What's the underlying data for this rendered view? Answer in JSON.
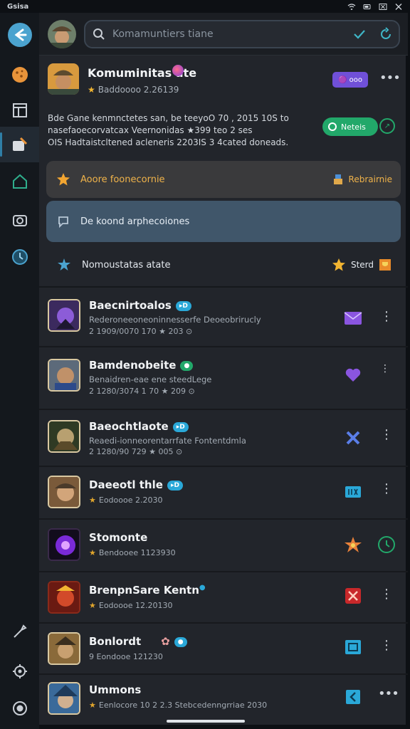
{
  "status": {
    "time": "Gsisa"
  },
  "search": {
    "placeholder": "Komamuntiers tiane"
  },
  "header": {
    "title": "Komuminitas ate",
    "subtitle": "Baddoooo 2.26139",
    "pill_label": "🟣 ooo"
  },
  "description": {
    "line1": "Bde Gane kenmnctetes san, be teeyoO 70 , 2015 10S to",
    "line2": "nasefaoecorvatcax Veernonidas ★399 teo 2 ses",
    "line3": "OIS Hadtaistcltened acleneris 2203IS 3 4cated doneads."
  },
  "follow_button": {
    "label": "Neteis"
  },
  "menu": [
    {
      "label": "Aoore foonecornie",
      "right_label": "Rebrairnie"
    },
    {
      "label": "De koond arphecoiones",
      "right_label": ""
    },
    {
      "label": "Nomoustatas atate",
      "right_label": "Sterd"
    }
  ],
  "games": [
    {
      "name": "Baecnirtoalos",
      "badge": "▸D",
      "line2": "Rederoneeoneoninnesserfe Deoeobrirucly",
      "line3": "2 1909/0070 170 ★ 203 ⊙"
    },
    {
      "name": "Bamdenobeite",
      "badge": "",
      "line2": "Benaidren-eae ene steedLege",
      "line3": "2 1280/3074 1 70 ★ 209 ⊙"
    },
    {
      "name": "Baeochtlaote",
      "badge": "▸D",
      "line2": "Reaedi-ionneorentarrfate Fontentdmla",
      "line3": "2 1280/90 729 ★ 005 ⊙"
    },
    {
      "name": "Daeeotl thle",
      "badge": "▸D",
      "line2": "",
      "line3": "Eodoooe 2.2030"
    },
    {
      "name": "Stomonte",
      "badge": "",
      "line2": "",
      "line3": "Bendooee 1123930"
    },
    {
      "name": "BrenpnSare Kentn",
      "badge": "",
      "line2": "",
      "line3": "Eodoooe 12.20130"
    },
    {
      "name": "Bonlordt",
      "badge": "",
      "line2": "",
      "line3": "9 Eondooe 121230"
    },
    {
      "name": "Ummons",
      "badge": "",
      "line2": "",
      "line3": "Eenlocore 10 2 2.3 Stebcedenngrriae 2030"
    }
  ],
  "colors": {
    "accent": "#2f7ea6",
    "green": "#22a86a",
    "purple": "#7050d8"
  }
}
